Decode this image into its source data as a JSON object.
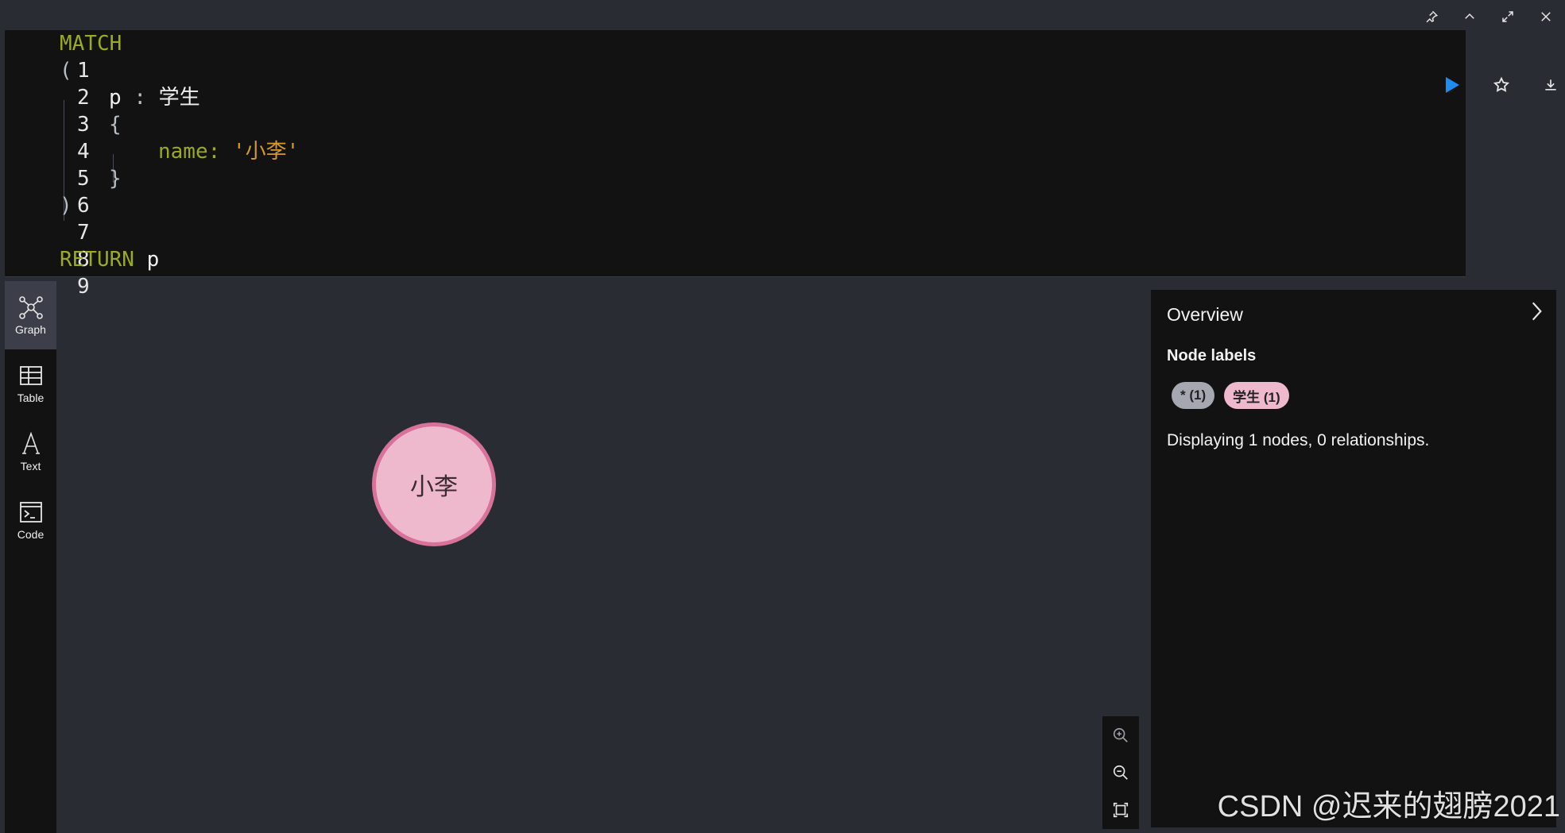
{
  "toolbar": {
    "icons": [
      "pin-icon",
      "collapse-up-icon",
      "expand-icon",
      "close-icon"
    ]
  },
  "editor": {
    "lines": [
      {
        "n": "1"
      },
      {
        "n": "2"
      },
      {
        "n": "3"
      },
      {
        "n": "4"
      },
      {
        "n": "5"
      },
      {
        "n": "6"
      },
      {
        "n": "7"
      },
      {
        "n": "8"
      },
      {
        "n": "9"
      }
    ],
    "code": {
      "match": "MATCH",
      "open_paren": "(",
      "var": "p",
      "colon": ":",
      "label": "学生",
      "open_brace": "{",
      "prop_key": "name:",
      "prop_val": "'小李'",
      "close_brace": "}",
      "close_paren": ")",
      "return_kw": "RETURN",
      "return_var": "p"
    },
    "actions": [
      "run-icon",
      "favorite-star-icon",
      "download-icon"
    ],
    "accent": "#1d8cf0"
  },
  "sidebar": {
    "items": [
      {
        "label": "Graph",
        "icon": "graph-icon"
      },
      {
        "label": "Table",
        "icon": "table-icon"
      },
      {
        "label": "Text",
        "icon": "text-icon"
      },
      {
        "label": "Code",
        "icon": "code-icon"
      }
    ]
  },
  "graph": {
    "node_label": "小李",
    "node_fill": "#efb9cd",
    "node_border": "#d9729a"
  },
  "zoom": {
    "icons": [
      "zoom-in-icon",
      "zoom-out-icon",
      "fit-screen-icon"
    ]
  },
  "overview": {
    "title": "Overview",
    "node_labels_heading": "Node labels",
    "badges": [
      {
        "text": "* (1)",
        "color": "#a5a8b0"
      },
      {
        "text": "学生 (1)",
        "color": "#efb9cd"
      }
    ],
    "summary": "Displaying 1 nodes, 0 relationships."
  },
  "watermark": "CSDN @迟来的翅膀2021"
}
